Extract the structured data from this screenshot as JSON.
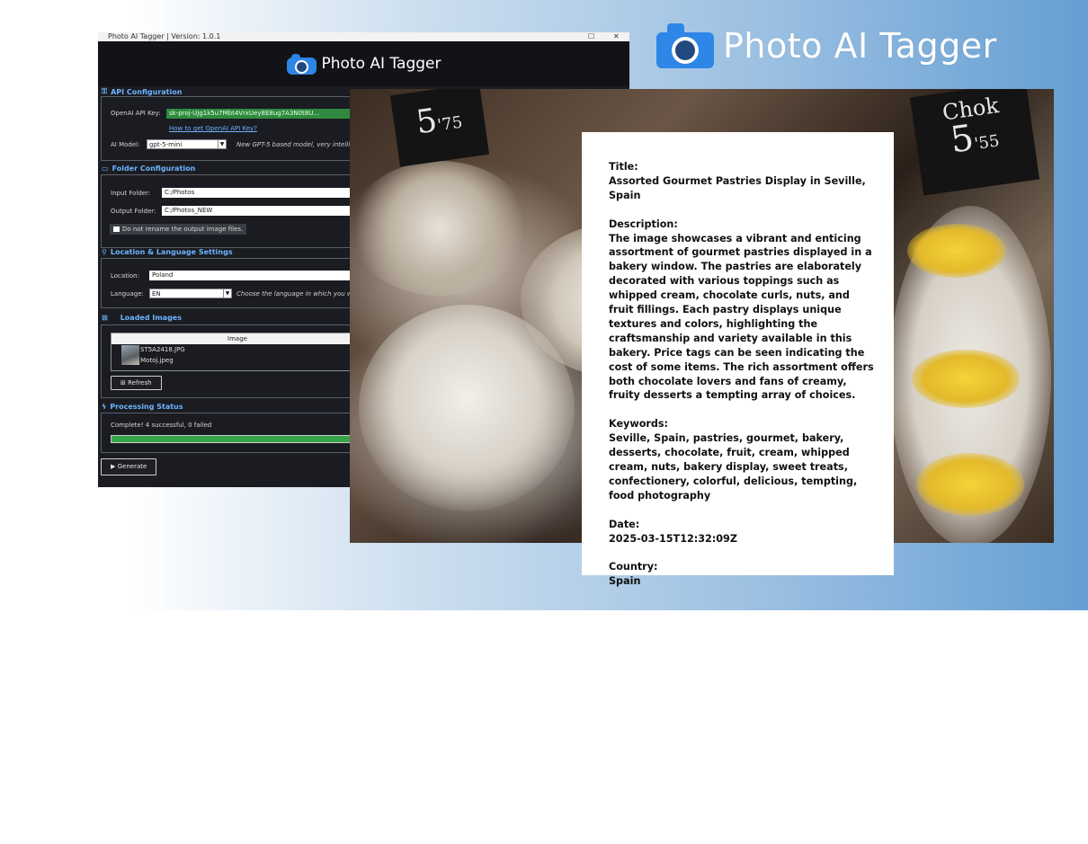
{
  "brand": {
    "title": "Photo AI Tagger"
  },
  "app": {
    "window_title": "Photo AI Tagger | Version: 1.0.1",
    "header_title": "Photo AI Tagger",
    "api": {
      "section_title": "API Configuration",
      "api_key_label": "OpenAI API Key:",
      "api_key_value": "sk-proj-UJg1k5u7Mbt4VrxUey8E8ug7A3N0t8U...",
      "api_key_link": "How to get OpenAI API Key?",
      "model_label": "AI Model:",
      "model_value": "gpt-5-mini",
      "model_hint": "New GPT-5 based model, very intellig..."
    },
    "folders": {
      "section_title": "Folder Configuration",
      "input_label": "Input Folder:",
      "input_value": "C:/Photos",
      "output_label": "Output Folder:",
      "output_value": "C:/Photos_NEW",
      "rename_checkbox": "Do not rename the output image files."
    },
    "location": {
      "section_title": "Location & Language Settings",
      "location_label": "Location:",
      "location_value": "Poland",
      "language_label": "Language:",
      "language_value": "EN",
      "language_hint": "Choose the language in which you wa..."
    },
    "images": {
      "section_title": "Loaded Images",
      "column_header": "Image",
      "rows": [
        "ST5A2418.JPG",
        "Motoj.jpeg"
      ],
      "refresh_button": "⊞ Refresh"
    },
    "status": {
      "section_title": "Processing Status",
      "status_text": "Complete! 4 successful, 0 failed",
      "progress": 1.0
    },
    "generate_button": "▶ Generate"
  },
  "photo": {
    "price_tag_left": "5",
    "price_tag_left_cents": "'75",
    "price_tag_right_word": "Chok",
    "price_tag_right": "5",
    "price_tag_right_cents": "'55"
  },
  "metadata": {
    "title_label": "Title:",
    "title": "Assorted Gourmet Pastries Display in Seville, Spain",
    "description_label": "Description:",
    "description": "The image showcases a vibrant and enticing assortment of gourmet pastries displayed in a bakery window. The pastries are elaborately decorated with various toppings such as whipped cream, chocolate curls, nuts, and fruit fillings. Each pastry displays unique textures and colors, highlighting the craftsmanship and variety available in this bakery. Price tags can be seen indicating the cost of some items. The rich assortment offers both chocolate lovers and fans of creamy, fruity desserts a tempting array of choices.",
    "keywords_label": "Keywords:",
    "keywords": "Seville, Spain, pastries, gourmet, bakery, desserts, chocolate, fruit, cream, whipped cream, nuts, bakery display, sweet treats, confectionery, colorful, delicious, tempting, food photography",
    "date_label": "Date:",
    "date": "2025-03-15T12:32:09Z",
    "country_label": "Country:",
    "country": "Spain"
  },
  "icons": [
    "camera-icon",
    "key-icon",
    "folder-icon",
    "pin-icon",
    "image-icon",
    "bolt-icon"
  ]
}
